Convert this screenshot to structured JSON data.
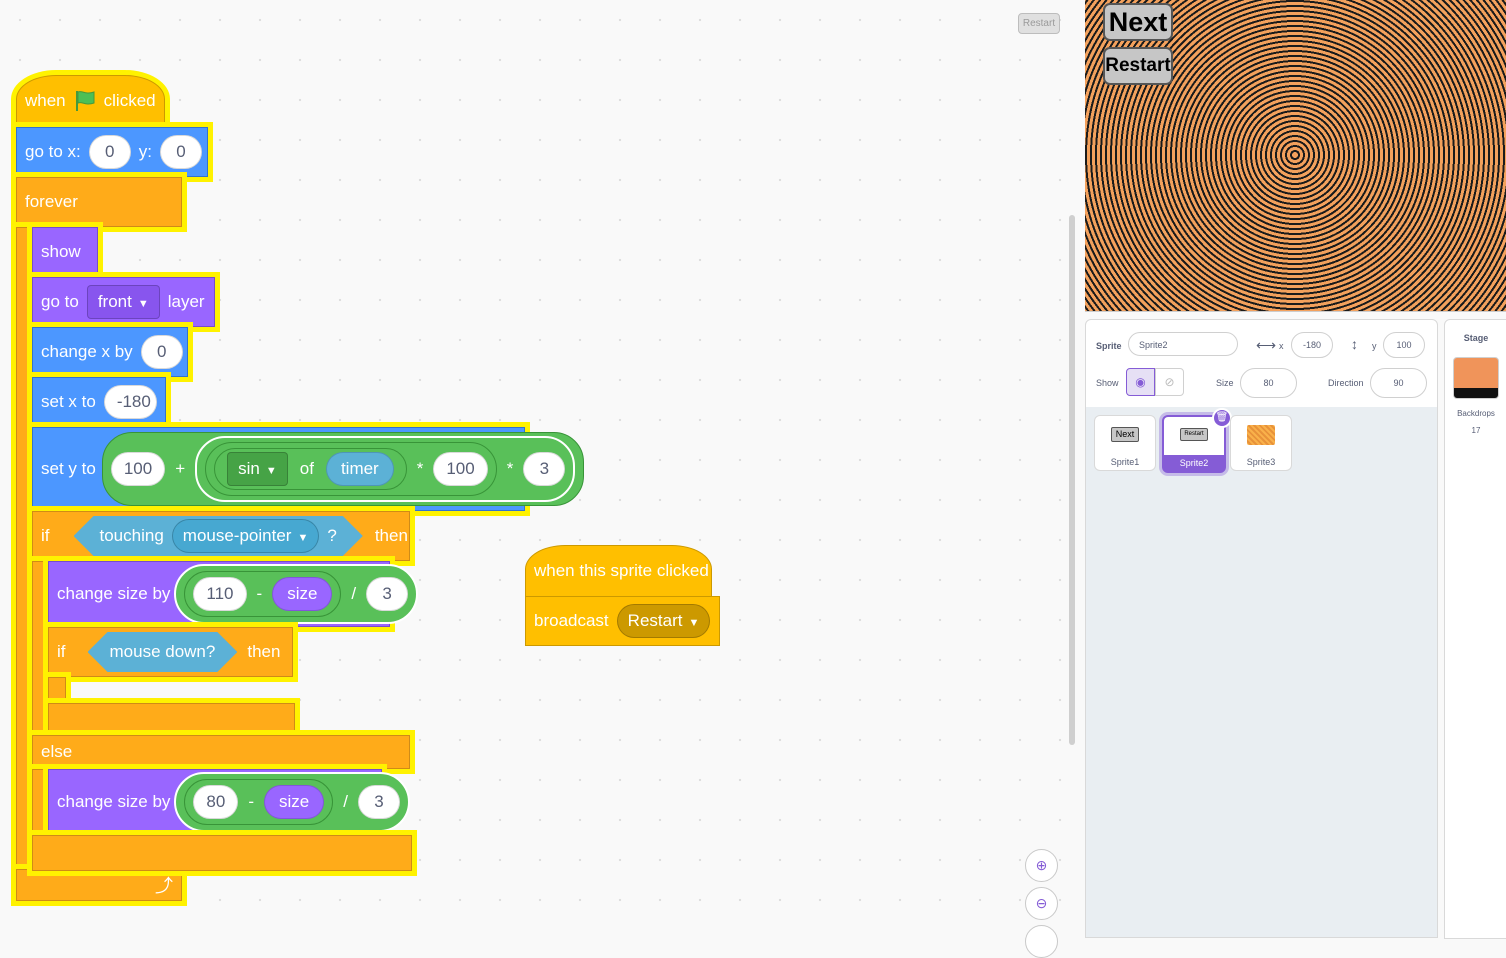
{
  "code": {
    "restart_small": "Restart",
    "script1": {
      "hat_when": "when",
      "hat_clicked": "clicked",
      "goto_label": "go to x:",
      "goto_x": "0",
      "goto_y_label": "y:",
      "goto_y": "0",
      "forever_label": "forever",
      "show_label": "show",
      "goto_layer_label": "go to",
      "goto_layer_value": "front",
      "goto_layer_suffix": "layer",
      "changex_label": "change x by",
      "changex_value": "0",
      "setx_label": "set x to",
      "setx_value": "-180",
      "sety_label": "set y to",
      "sety_base": "100",
      "plus": "+",
      "sin_value": "sin",
      "of_label": "of",
      "timer_label": "timer",
      "times": "*",
      "sety_mult1": "100",
      "sety_mult2": "3",
      "if_label": "if",
      "touching_label": "touching",
      "touching_value": "mouse-pointer",
      "question": "?",
      "then_label": "then",
      "changesize_label": "change size by",
      "size1_a": "110",
      "minus": "-",
      "size_reporter": "size",
      "divide": "/",
      "size1_div": "3",
      "if2_label": "if",
      "mouse_down_label": "mouse down?",
      "then2_label": "then",
      "else_label": "else",
      "changesize2_label": "change size by",
      "size2_a": "80",
      "size2_div": "3"
    },
    "script2": {
      "hat_label": "when this sprite clicked",
      "broadcast_label": "broadcast",
      "broadcast_value": "Restart"
    }
  },
  "stage": {
    "next_button": "Next",
    "restart_button": "Restart"
  },
  "sprite_info": {
    "sprite_label": "Sprite",
    "sprite_name": "Sprite2",
    "x_label": "x",
    "x_value": "-180",
    "y_label": "y",
    "y_value": "100",
    "show_label": "Show",
    "size_label": "Size",
    "size_value": "80",
    "direction_label": "Direction",
    "direction_value": "90"
  },
  "sprites": [
    {
      "name": "Sprite1",
      "thumb": "Next"
    },
    {
      "name": "Sprite2",
      "thumb": "Restart"
    },
    {
      "name": "Sprite3",
      "thumb": "Sprite3"
    }
  ],
  "stage_panel": {
    "title": "Stage",
    "backdrops_label": "Backdrops",
    "backdrops_count": "17"
  },
  "colors": {
    "events": "#ffbf00",
    "control": "#ffab19",
    "motion": "#4c97ff",
    "looks": "#9966ff",
    "operators": "#59c059",
    "sensing": "#5cb1d6",
    "highlight": "#fff200",
    "accent": "#855cd6"
  }
}
